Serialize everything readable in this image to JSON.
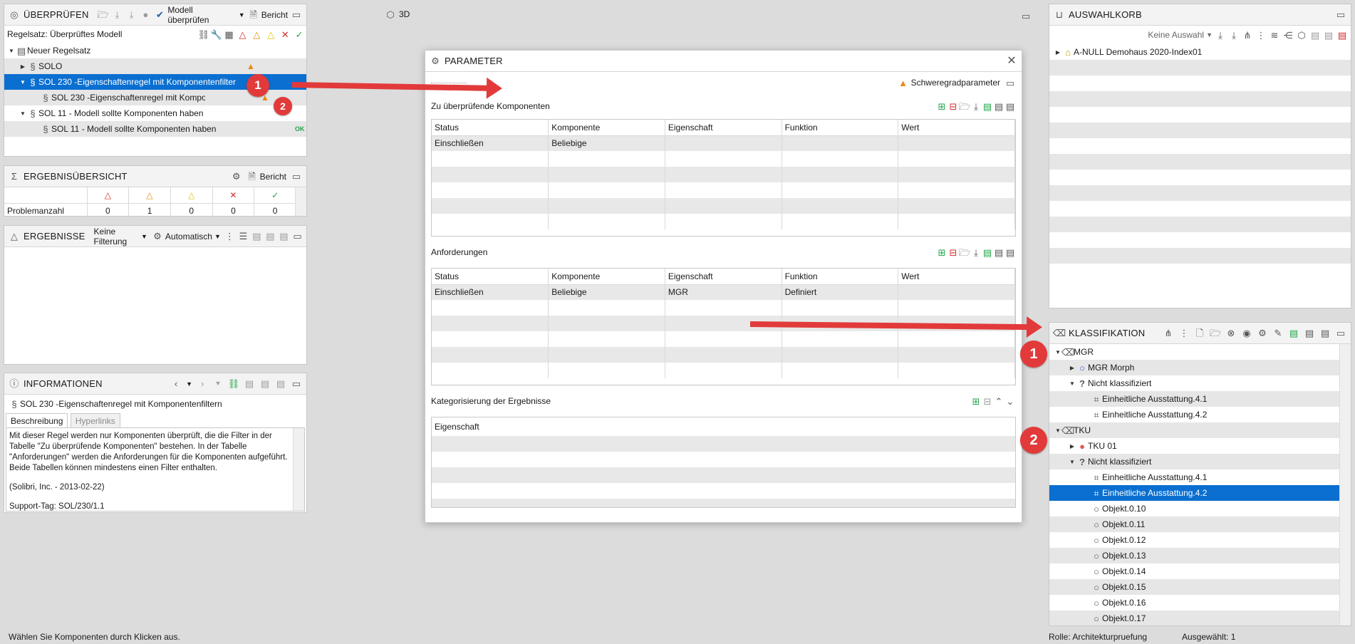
{
  "colors": {
    "accent": "#0a6fd0",
    "red": "#d02b2b",
    "orange": "#e98a15",
    "yellow": "#e6c200",
    "green": "#22a64a",
    "annotation": "#e23a3a"
  },
  "ueberpruefen": {
    "title": "ÜBERPRÜFEN",
    "check_model_label": "Modell überprüfen",
    "report_label": "Bericht",
    "ruleset_label": "Regelsatz: Überprüftes Modell",
    "tree": [
      {
        "label": "Neuer Regelsatz",
        "result": ""
      },
      {
        "label": "SOLO",
        "result": "▲"
      },
      {
        "label": "SOL 230 -Eigenschaftenregel mit Komponentenfilter",
        "result": ""
      },
      {
        "label": "SOL 230 -Eigenschaftenregel mit Komponentenf",
        "result": "▲"
      },
      {
        "label": "SOL 11 - Modell sollte Komponenten haben",
        "result": ""
      },
      {
        "label": "SOL 11 - Modell sollte Komponenten haben",
        "result": "OK"
      }
    ]
  },
  "ergebnisuebersicht": {
    "title": "ERGEBNISÜBERSICHT",
    "report_label": "Bericht",
    "row_label": "Problemanzahl",
    "counts": [
      "0",
      "1",
      "0",
      "0",
      "0"
    ]
  },
  "ergebnisse": {
    "title": "ERGEBNISSE",
    "filter_label": "Keine Filterung",
    "auto_label": "Automatisch"
  },
  "informationen": {
    "title": "INFORMATIONEN",
    "rule_name": "SOL 230 -Eigenschaftenregel mit Komponentenfiltern",
    "tab_description": "Beschreibung",
    "tab_hyperlinks": "Hyperlinks",
    "description": "Mit dieser Regel werden nur Komponenten überprüft, die die Filter in der Tabelle \"Zu überprüfende Komponenten\" bestehen. In der Tabelle \"Anforderungen\" werden die Anforderungen für die Komponenten aufgeführt. Beide Tabellen können mindestens einen Filter enthalten.",
    "copyright": "(Solibri, Inc. - 2013-02-22)",
    "support_tag": "Support-Tag: SOL/230/1.1"
  },
  "view3d": {
    "title": "3D"
  },
  "parameter": {
    "title": "PARAMETER",
    "severity_label": "Schweregradparameter",
    "components_section": "Zu überprüfende Komponenten",
    "requirements_section": "Anforderungen",
    "categorization_section": "Kategorisierung der Ergebnisse",
    "columns": [
      "Status",
      "Komponente",
      "Eigenschaft",
      "Funktion",
      "Wert"
    ],
    "components_rows": [
      [
        "Einschließen",
        "Beliebige",
        "",
        "",
        ""
      ]
    ],
    "requirements_rows": [
      [
        "Einschließen",
        "Beliebige",
        "MGR",
        "Definiert",
        ""
      ]
    ],
    "categorization_header": "Eigenschaft"
  },
  "auswahlkorb": {
    "title": "AUSWAHLKORB",
    "selection_label": "Keine Auswahl",
    "item": "A-NULL Demohaus 2020-Index01"
  },
  "klassifikation": {
    "title": "KLASSIFIKATION",
    "tree": [
      {
        "label": "MGR"
      },
      {
        "label": "MGR Morph"
      },
      {
        "label": "Nicht klassifiziert"
      },
      {
        "label": "Einheitliche Ausstattung.4.1"
      },
      {
        "label": "Einheitliche Ausstattung.4.2"
      },
      {
        "label": "TKU"
      },
      {
        "label": "TKU 01"
      },
      {
        "label": "Nicht klassifiziert"
      },
      {
        "label": "Einheitliche Ausstattung.4.1"
      },
      {
        "label": "Einheitliche Ausstattung.4.2"
      },
      {
        "label": "Objekt.0.10"
      },
      {
        "label": "Objekt.0.11"
      },
      {
        "label": "Objekt.0.12"
      },
      {
        "label": "Objekt.0.13"
      },
      {
        "label": "Objekt.0.14"
      },
      {
        "label": "Objekt.0.15"
      },
      {
        "label": "Objekt.0.16"
      },
      {
        "label": "Objekt.0.17"
      }
    ]
  },
  "annotations": {
    "one": "1",
    "two": "2"
  },
  "statusbar": {
    "left": "Wählen Sie Komponenten durch Klicken aus.",
    "role": "Rolle: Architekturpruefung",
    "selected": "Ausgewählt: 1"
  }
}
